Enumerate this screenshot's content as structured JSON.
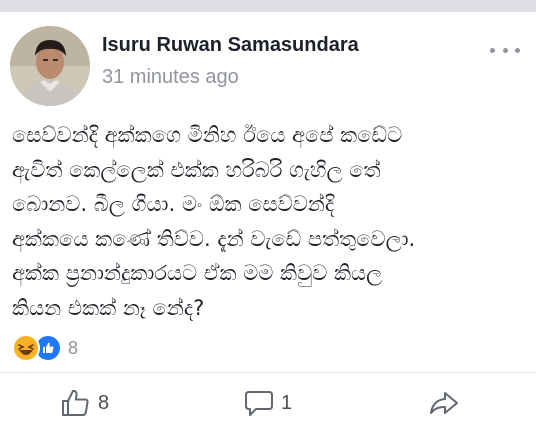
{
  "post": {
    "author": "Isuru Ruwan Samasundara",
    "time": "31 minutes ago",
    "text_lines": [
      "සෙව්වන්දි අක්කගෙ මිනිහ ඊයෙ අපේ කඩේට",
      "ඇවිත් කෙල්ලෙක් එක්ක හරිබරි ගැහිල තේ",
      "බොනව. බීල ගියා. මං ඕක සෙව්වන්දි",
      "අක්කයෙ කණේ තිව්ව. දැන් වැඩේ පත්තුවෙලා.",
      "අක්ක ප්‍රනාන්දුකාරයට ඒක මම කිවුව කියල",
      "කියන එකක් නෑ නේද?"
    ],
    "reaction_icons": [
      "haha-icon",
      "like-icon"
    ],
    "reaction_count": "8"
  },
  "actions": {
    "like_count": "8",
    "comment_count": "1",
    "share_icon": "share-arrow-icon"
  },
  "colors": {
    "author": "#1d2129",
    "meta": "#90949c",
    "like_blue": "#2078f4",
    "haha_yellow": "#f7b125",
    "divider": "#e5e6e9"
  }
}
